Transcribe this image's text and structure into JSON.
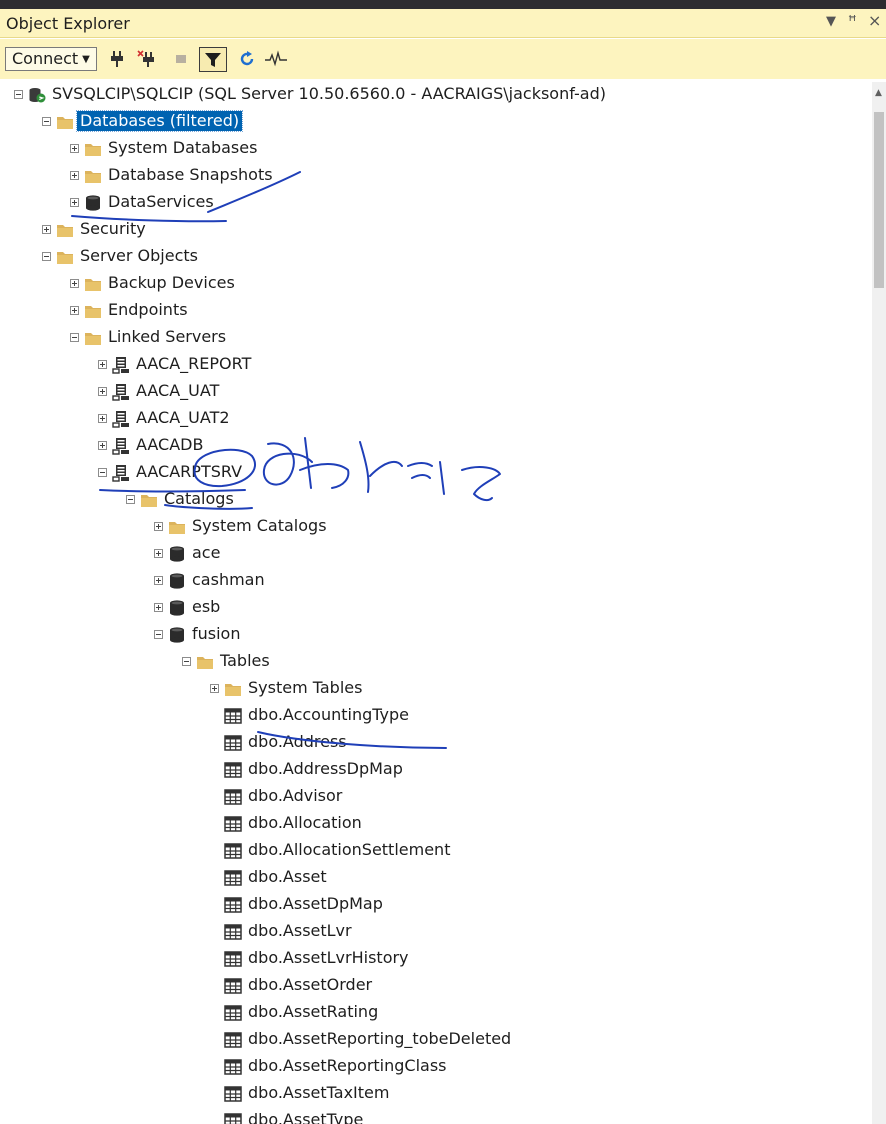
{
  "panel": {
    "title": "Object Explorer",
    "pin_glyph": "▾  ᵽ  ×"
  },
  "toolbar": {
    "connect_label": "Connect",
    "icons": [
      "connect-plug-icon",
      "disconnect-plug-icon",
      "stop-icon",
      "filter-icon",
      "refresh-icon",
      "activity-monitor-icon"
    ]
  },
  "colors": {
    "panel_header_bg": "#fdf4bf",
    "selection_bg": "#0063b1",
    "folder": "#dcb35c",
    "annotation_ink": "#1f3fb8"
  },
  "tree": [
    {
      "level": 0,
      "exp": "minus",
      "icon": "server",
      "label": "SVSQLCIP\\SQLCIP (SQL Server 10.50.6560.0 - AACRAIGS\\jacksonf-ad)"
    },
    {
      "level": 1,
      "exp": "minus",
      "icon": "folder",
      "label": "Databases (filtered)",
      "selected": true
    },
    {
      "level": 2,
      "exp": "plus",
      "icon": "folder",
      "label": "System Databases"
    },
    {
      "level": 2,
      "exp": "plus",
      "icon": "folder",
      "label": "Database Snapshots"
    },
    {
      "level": 2,
      "exp": "plus",
      "icon": "database",
      "label": "DataServices"
    },
    {
      "level": 1,
      "exp": "plus",
      "icon": "folder",
      "label": "Security"
    },
    {
      "level": 1,
      "exp": "minus",
      "icon": "folder",
      "label": "Server Objects"
    },
    {
      "level": 2,
      "exp": "plus",
      "icon": "folder",
      "label": "Backup Devices"
    },
    {
      "level": 2,
      "exp": "plus",
      "icon": "folder",
      "label": "Endpoints"
    },
    {
      "level": 2,
      "exp": "minus",
      "icon": "folder",
      "label": "Linked Servers"
    },
    {
      "level": 3,
      "exp": "plus",
      "icon": "linked",
      "label": "AACA_REPORT"
    },
    {
      "level": 3,
      "exp": "plus",
      "icon": "linked",
      "label": "AACA_UAT"
    },
    {
      "level": 3,
      "exp": "plus",
      "icon": "linked",
      "label": "AACA_UAT2"
    },
    {
      "level": 3,
      "exp": "plus",
      "icon": "linked",
      "label": "AACADB"
    },
    {
      "level": 3,
      "exp": "minus",
      "icon": "linked",
      "label": "AACARPTSRV"
    },
    {
      "level": 4,
      "exp": "minus",
      "icon": "folder",
      "label": "Catalogs"
    },
    {
      "level": 5,
      "exp": "plus",
      "icon": "folder",
      "label": "System Catalogs"
    },
    {
      "level": 5,
      "exp": "plus",
      "icon": "database",
      "label": "ace"
    },
    {
      "level": 5,
      "exp": "plus",
      "icon": "database",
      "label": "cashman"
    },
    {
      "level": 5,
      "exp": "plus",
      "icon": "database",
      "label": "esb"
    },
    {
      "level": 5,
      "exp": "minus",
      "icon": "database",
      "label": "fusion"
    },
    {
      "level": 6,
      "exp": "minus",
      "icon": "folder",
      "label": "Tables"
    },
    {
      "level": 7,
      "exp": "plus",
      "icon": "folder",
      "label": "System Tables"
    },
    {
      "level": 7,
      "exp": "none",
      "icon": "table",
      "label": "dbo.AccountingType"
    },
    {
      "level": 7,
      "exp": "none",
      "icon": "table",
      "label": "dbo.Address"
    },
    {
      "level": 7,
      "exp": "none",
      "icon": "table",
      "label": "dbo.AddressDpMap"
    },
    {
      "level": 7,
      "exp": "none",
      "icon": "table",
      "label": "dbo.Advisor"
    },
    {
      "level": 7,
      "exp": "none",
      "icon": "table",
      "label": "dbo.Allocation"
    },
    {
      "level": 7,
      "exp": "none",
      "icon": "table",
      "label": "dbo.AllocationSettlement"
    },
    {
      "level": 7,
      "exp": "none",
      "icon": "table",
      "label": "dbo.Asset"
    },
    {
      "level": 7,
      "exp": "none",
      "icon": "table",
      "label": "dbo.AssetDpMap"
    },
    {
      "level": 7,
      "exp": "none",
      "icon": "table",
      "label": "dbo.AssetLvr"
    },
    {
      "level": 7,
      "exp": "none",
      "icon": "table",
      "label": "dbo.AssetLvrHistory"
    },
    {
      "level": 7,
      "exp": "none",
      "icon": "table",
      "label": "dbo.AssetOrder"
    },
    {
      "level": 7,
      "exp": "none",
      "icon": "table",
      "label": "dbo.AssetRating"
    },
    {
      "level": 7,
      "exp": "none",
      "icon": "table",
      "label": "dbo.AssetReporting_tobeDeleted"
    },
    {
      "level": 7,
      "exp": "none",
      "icon": "table",
      "label": "dbo.AssetReportingClass"
    },
    {
      "level": 7,
      "exp": "none",
      "icon": "table",
      "label": "dbo.AssetTaxItem"
    },
    {
      "level": 7,
      "exp": "none",
      "icon": "table",
      "label": "dbo.AssetType"
    }
  ]
}
